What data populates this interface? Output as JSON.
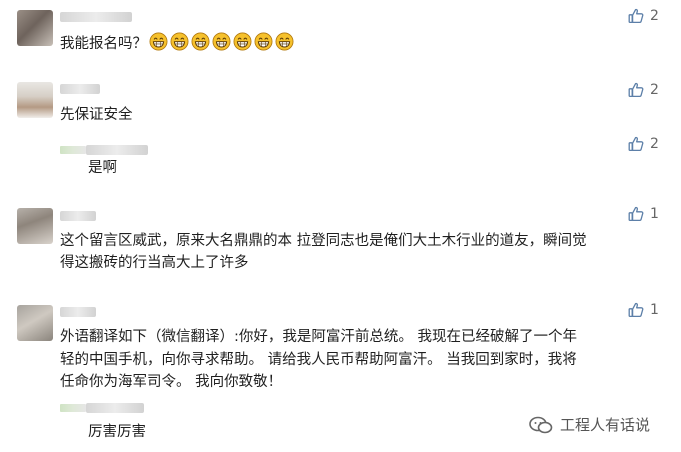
{
  "comments": [
    {
      "text": "我能报名吗？",
      "likes": "2",
      "emoji": {
        "name": "grin-emoji",
        "count": 7
      }
    },
    {
      "text": "先保证安全",
      "likes": "2",
      "reply": {
        "text": "是啊",
        "likes": "2"
      }
    },
    {
      "lines": [
        "这个留言区威武，原来大名鼎鼎的本 拉登同志也是俺们大土木行业的道友，瞬间觉",
        "得这搬砖的行当高大上了许多"
      ],
      "likes": "1"
    },
    {
      "lines": [
        "外语翻译如下（微信翻译）:你好，我是阿富汗前总统。 我现在已经破解了一个年",
        "轻的中国手机，向你寻求帮助。 请给我人民币帮助阿富汗。 当我回到家时，我将",
        "任命你为海军司令。 我向你致敬！"
      ],
      "likes": "1",
      "reply": {
        "text": "厉害厉害"
      }
    }
  ],
  "watermark": {
    "text": "工程人有话说",
    "icon": "wechat-account-icon"
  },
  "colors": {
    "like_icon": "#5c7fa8",
    "emoji_face": "#f6c12c",
    "emoji_outline": "#b27a10"
  }
}
